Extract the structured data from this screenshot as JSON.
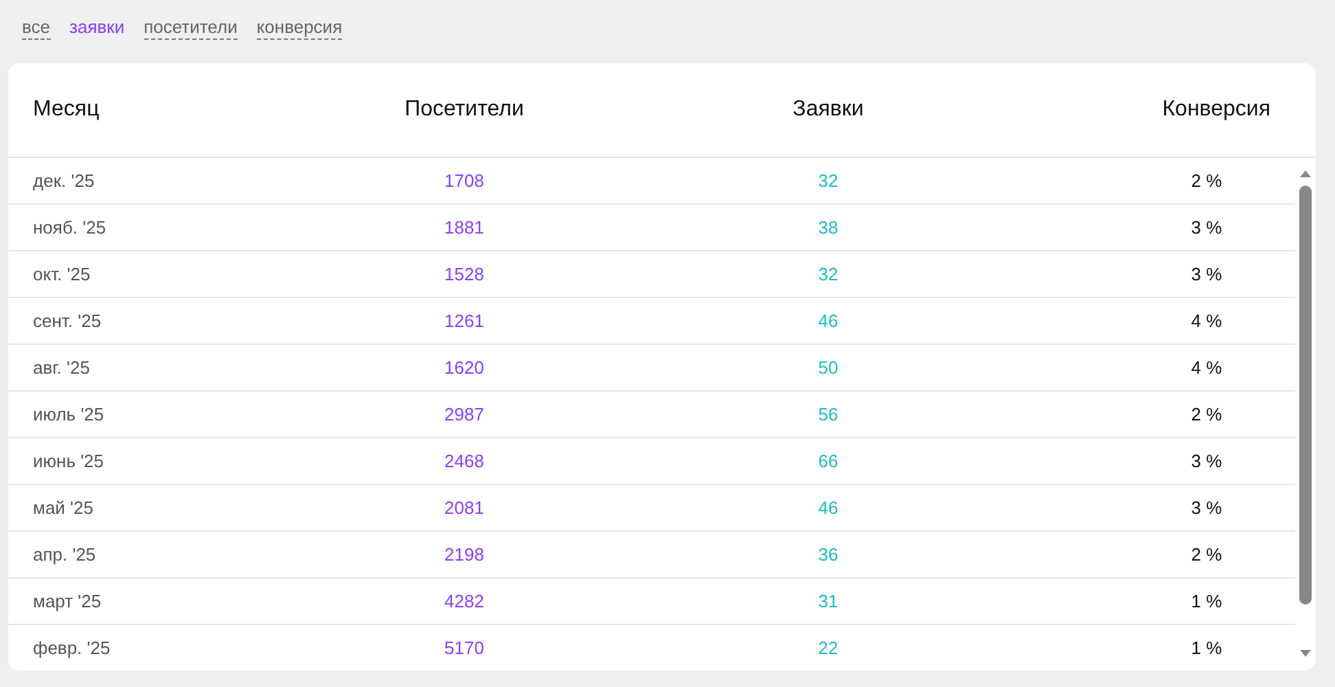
{
  "filters": [
    {
      "label": "все",
      "selected": false
    },
    {
      "label": "заявки",
      "selected": true
    },
    {
      "label": "посетители",
      "selected": false
    },
    {
      "label": "конверсия",
      "selected": false
    }
  ],
  "table": {
    "columns": [
      "Месяц",
      "Посетители",
      "Заявки",
      "Конверсия"
    ],
    "rows": [
      {
        "month": "дек. '25",
        "visitors": "1708",
        "requests": "32",
        "conversion": "2 %"
      },
      {
        "month": "нояб. '25",
        "visitors": "1881",
        "requests": "38",
        "conversion": "3 %"
      },
      {
        "month": "окт. '25",
        "visitors": "1528",
        "requests": "32",
        "conversion": "3 %"
      },
      {
        "month": "сент. '25",
        "visitors": "1261",
        "requests": "46",
        "conversion": "4 %"
      },
      {
        "month": "авг. '25",
        "visitors": "1620",
        "requests": "50",
        "conversion": "4 %"
      },
      {
        "month": "июль '25",
        "visitors": "2987",
        "requests": "56",
        "conversion": "2 %"
      },
      {
        "month": "июнь '25",
        "visitors": "2468",
        "requests": "66",
        "conversion": "3 %"
      },
      {
        "month": "май '25",
        "visitors": "2081",
        "requests": "46",
        "conversion": "3 %"
      },
      {
        "month": "апр. '25",
        "visitors": "2198",
        "requests": "36",
        "conversion": "2 %"
      },
      {
        "month": "март '25",
        "visitors": "4282",
        "requests": "31",
        "conversion": "1 %"
      },
      {
        "month": "февр. '25",
        "visitors": "5170",
        "requests": "22",
        "conversion": "1 %"
      }
    ]
  }
}
